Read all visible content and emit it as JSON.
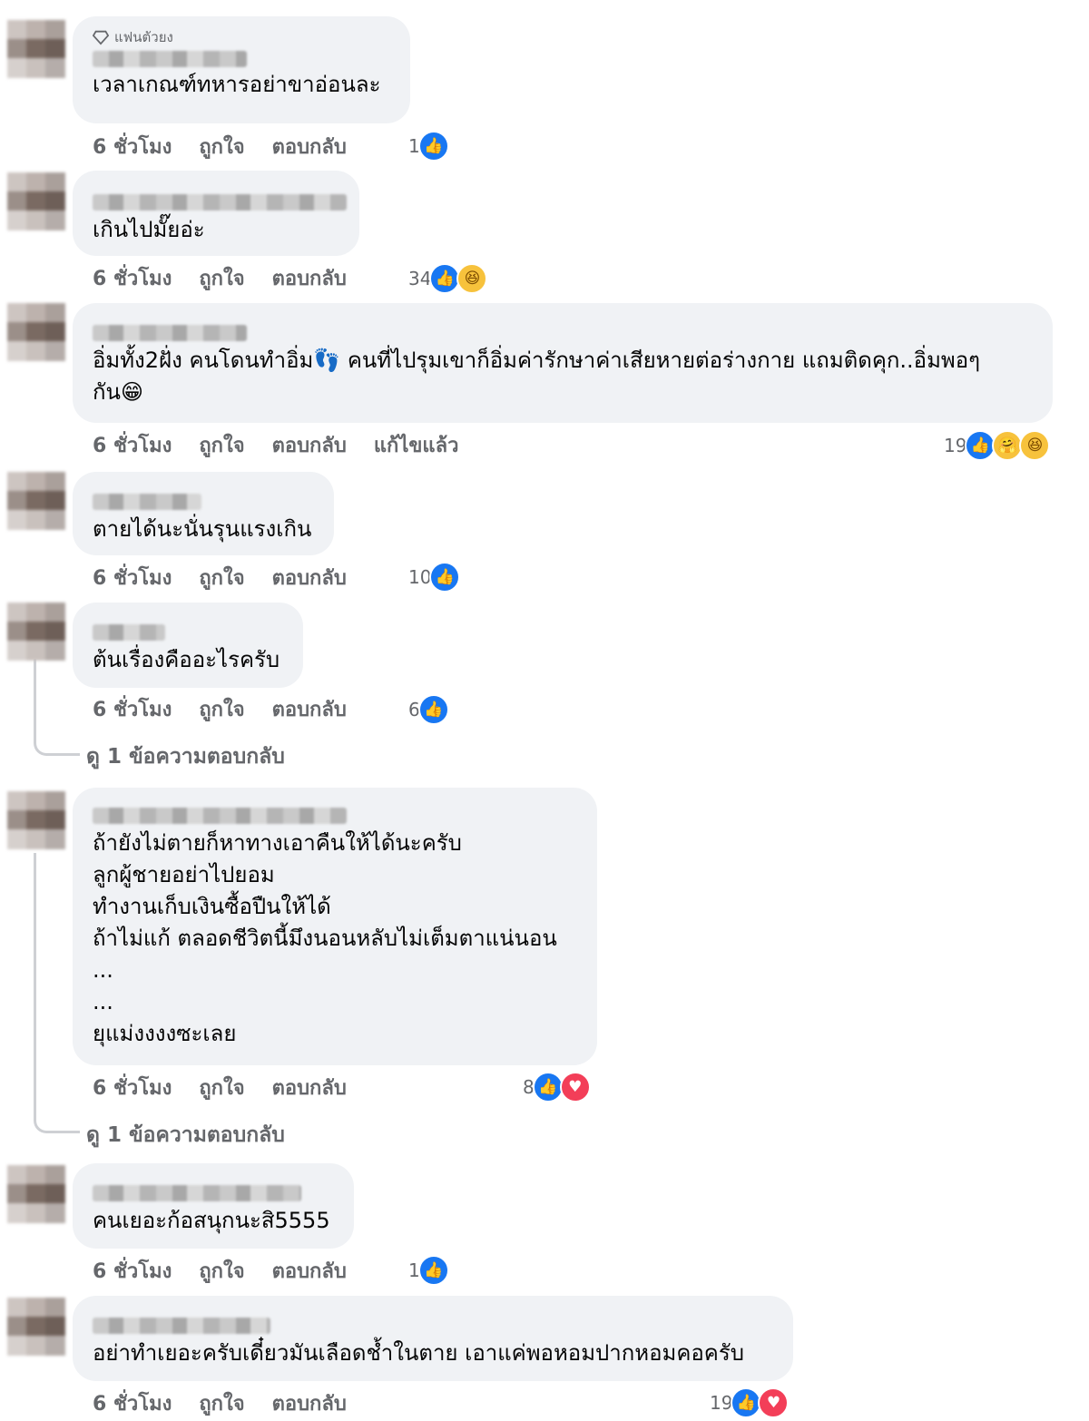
{
  "comments": [
    {
      "badge": "แฟนตัวยง",
      "text": "เวลาเกณฑ์ทหารอย่าขาอ่อนละ",
      "time": "6 ชั่วโมง",
      "like": "ถูกใจ",
      "reply": "ตอบกลับ",
      "count": "1",
      "reactions": [
        "like-icon"
      ]
    },
    {
      "text": "เกินไปมั๊ยอ่ะ",
      "time": "6 ชั่วโมง",
      "like": "ถูกใจ",
      "reply": "ตอบกลับ",
      "count": "34",
      "reactions": [
        "like-icon",
        "haha-icon"
      ]
    },
    {
      "text": "อิ่มทั้ง2ฝั่ง คนโดนทำอิ่ม👣 คนที่ไปรุมเขาก็อิ่มค่ารักษาค่าเสียหายต่อร่างกาย แถมติดคุก..อิ่มพอๆ\nกัน😁",
      "time": "6 ชั่วโมง",
      "like": "ถูกใจ",
      "reply": "ตอบกลับ",
      "edited": "แก้ไขแล้ว",
      "count": "19",
      "reactions": [
        "like-icon",
        "care-icon",
        "haha-icon"
      ]
    },
    {
      "text": "ตายได้นะนั่นรุนแรงเกิน",
      "time": "6 ชั่วโมง",
      "like": "ถูกใจ",
      "reply": "ตอบกลับ",
      "count": "10",
      "reactions": [
        "like-icon"
      ]
    },
    {
      "text": "ต้นเรื่องคืออะไรครับ",
      "time": "6 ชั่วโมง",
      "like": "ถูกใจ",
      "reply": "ตอบกลับ",
      "count": "6",
      "reactions": [
        "like-icon"
      ],
      "view_replies": "ดู 1 ข้อความตอบกลับ"
    },
    {
      "text": "ถ้ายังไม่ตายก็หาทางเอาคืนให้ได้นะครับ\nลูกผู้ชายอย่าไปยอม\nทำงานเก็บเงินซื้อปืนให้ได้\nถ้าไม่แก้ ตลอดชีวิตนี้มึงนอนหลับไม่เต็มตาแน่นอน\n...\n...\nยุแม่งงงงซะเลย",
      "time": "6 ชั่วโมง",
      "like": "ถูกใจ",
      "reply": "ตอบกลับ",
      "count": "8",
      "reactions": [
        "like-icon",
        "love-icon"
      ],
      "view_replies": "ดู 1 ข้อความตอบกลับ"
    },
    {
      "text": "คนเยอะก้อสนุกนะสิ5555",
      "time": "6 ชั่วโมง",
      "like": "ถูกใจ",
      "reply": "ตอบกลับ",
      "count": "1",
      "reactions": [
        "like-icon"
      ]
    },
    {
      "text": "อย่าทำเยอะครับเดี๋ยวมันเลือดช้ำในตาย เอาแค่พอหอมปากหอมคอครับ",
      "time": "6 ชั่วโมง",
      "like": "ถูกใจ",
      "reply": "ตอบกลับ",
      "count": "19",
      "reactions": [
        "like-icon",
        "love-icon"
      ]
    }
  ],
  "colors": {
    "bubble": "#f0f2f5",
    "meta": "#65676b",
    "like": "#1877f2",
    "love": "#f33e58",
    "haha": "#f7c23c"
  }
}
